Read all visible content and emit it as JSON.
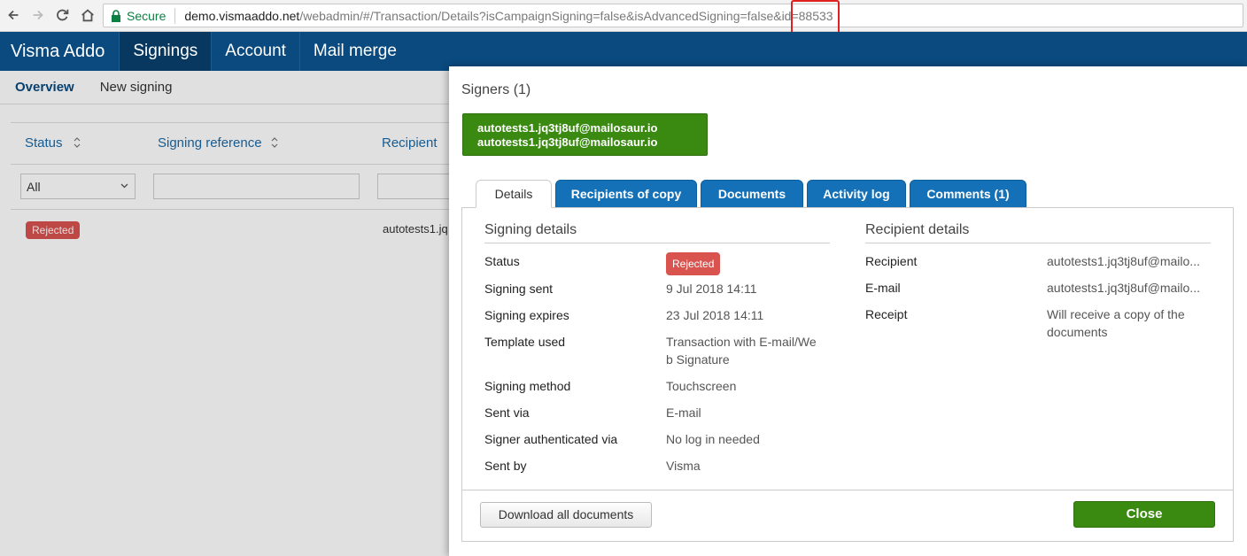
{
  "browser": {
    "secure_label": "Secure",
    "url_host": "demo.vismaaddo.net",
    "url_path": "/webadmin/#/Transaction/Details?isCampaignSigning=false&isAdvancedSigning=false&id=88533"
  },
  "header": {
    "brand": "Visma Addo",
    "nav": [
      "Signings",
      "Account",
      "Mail merge"
    ]
  },
  "subnav": [
    "Overview",
    "New signing"
  ],
  "list": {
    "columns": [
      "Status",
      "Signing reference",
      "Recipient"
    ],
    "status_filter": "All",
    "row": {
      "status": "Rejected",
      "recipient": "autotests1.jq"
    }
  },
  "modal": {
    "title": "Signers (1)",
    "signer_lines": [
      "autotests1.jq3tj8uf@mailosaur.io",
      "autotests1.jq3tj8uf@mailosaur.io"
    ],
    "tabs": [
      "Details",
      "Recipients of copy",
      "Documents",
      "Activity log",
      "Comments (1)"
    ],
    "signing_details": {
      "title": "Signing details",
      "rows": [
        {
          "label": "Status",
          "value": "Rejected"
        },
        {
          "label": "Signing sent",
          "value": "9 Jul 2018 14:11"
        },
        {
          "label": "Signing expires",
          "value": "23 Jul 2018 14:11"
        },
        {
          "label": "Template used",
          "value_line1": "Transaction with E-mail/We",
          "value_line2": "b Signature"
        },
        {
          "label": "Signing method",
          "value": "Touchscreen"
        },
        {
          "label": "Sent via",
          "value": "E-mail"
        },
        {
          "label": "Signer authenticated via",
          "value": "No log in needed"
        },
        {
          "label": "Sent by",
          "value": "Visma"
        }
      ]
    },
    "recipient_details": {
      "title": "Recipient details",
      "rows": [
        {
          "label": "Recipient",
          "value": "autotests1.jq3tj8uf@mailo..."
        },
        {
          "label": "E-mail",
          "value": "autotests1.jq3tj8uf@mailo..."
        },
        {
          "label": "Receipt",
          "value_line1": "Will receive a copy of the",
          "value_line2": "documents"
        }
      ]
    },
    "download_label": "Download all documents",
    "close_label": "Close"
  },
  "colors": {
    "header": "#0a4a7f",
    "tab": "#1471b8",
    "success": "#3a8a12",
    "danger": "#d9534f"
  }
}
